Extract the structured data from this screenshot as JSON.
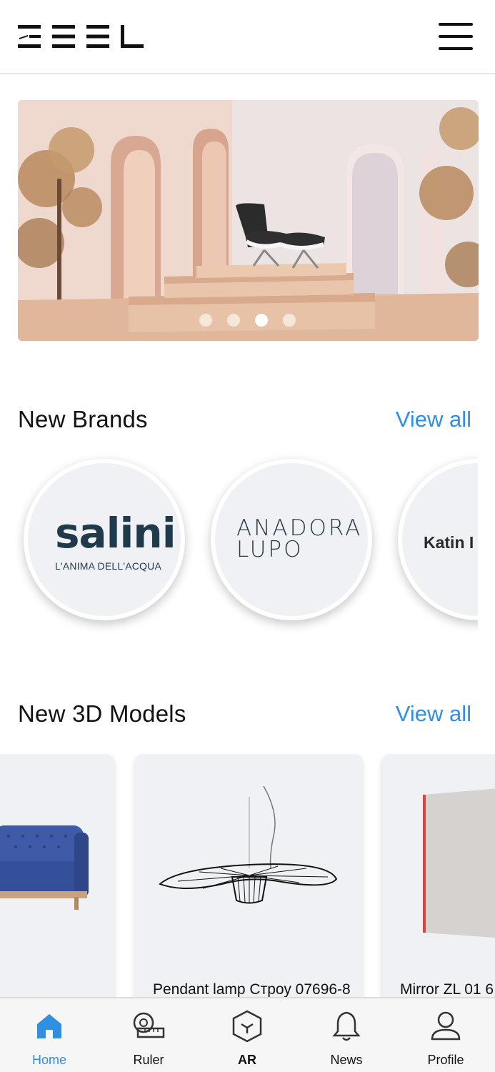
{
  "header": {
    "logo_icon": "zeel-logo",
    "menu_icon": "hamburger-menu-icon"
  },
  "banner": {
    "slide_count": 4,
    "active_slide": 3
  },
  "brands": {
    "title": "New Brands",
    "view_all": "View all",
    "items": [
      {
        "name": "salini",
        "tagline": "L'ANIMA DELL'ACQUA"
      },
      {
        "name_line1": "ANADORA",
        "name_line2": "LUPO"
      },
      {
        "name": "Katin I"
      }
    ]
  },
  "models": {
    "title": "New 3D Models",
    "view_all": "View all",
    "items": [
      {
        "name": ""
      },
      {
        "name": "Pendant lamp Строу 07696-8"
      },
      {
        "name": "Mirror ZL 01 6"
      }
    ]
  },
  "nav": {
    "items": [
      {
        "label": "Home",
        "icon": "home-icon",
        "active": true
      },
      {
        "label": "Ruler",
        "icon": "ruler-tape-icon"
      },
      {
        "label": "AR",
        "icon": "ar-cube-icon"
      },
      {
        "label": "News",
        "icon": "bell-icon"
      },
      {
        "label": "Profile",
        "icon": "profile-icon"
      }
    ]
  },
  "colors": {
    "accent": "#2f8fe0",
    "text": "#111111",
    "card_bg": "#f0f1f5"
  }
}
